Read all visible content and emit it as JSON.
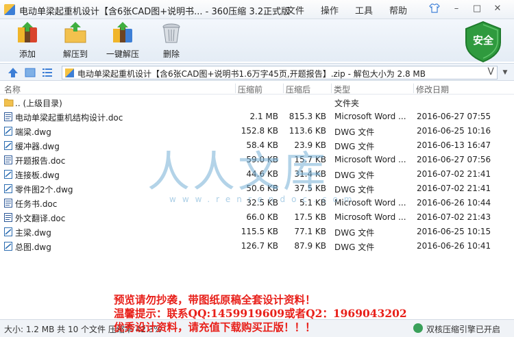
{
  "window": {
    "title": "电动单梁起重机设计【含6张CAD图+说明书... - 360压缩 3.2正式版",
    "menu": [
      "文件",
      "操作",
      "工具",
      "帮助"
    ],
    "controls": [
      "shirt-icon",
      "minimize-icon",
      "maximize-icon",
      "close-icon"
    ]
  },
  "toolbar": {
    "add_label": "添加",
    "extract_to_label": "解压到",
    "one_click_extract_label": "一键解压",
    "delete_label": "删除",
    "security_badge": "安全"
  },
  "address": {
    "path": "电动单梁起重机设计【含6张CAD图+说明书1.6万字45页,开题报告】.zip - 解包大小为 2.8 MB",
    "shortcut": "V"
  },
  "columns": [
    "名称",
    "压缩前",
    "压缩后",
    "类型",
    "修改日期"
  ],
  "files": [
    {
      "name": ".. (上级目录)",
      "size": "",
      "csize": "",
      "type": "文件夹",
      "date": "",
      "icon": "folder-icon"
    },
    {
      "name": "电动单梁起重机结构设计.doc",
      "size": "2.1 MB",
      "csize": "815.3 KB",
      "type": "Microsoft Word ...",
      "date": "2016-06-27 07:55",
      "icon": "doc-icon"
    },
    {
      "name": "端梁.dwg",
      "size": "152.8 KB",
      "csize": "113.6 KB",
      "type": "DWG 文件",
      "date": "2016-06-25 10:16",
      "icon": "dwg-icon"
    },
    {
      "name": "缓冲器.dwg",
      "size": "58.4 KB",
      "csize": "23.9 KB",
      "type": "DWG 文件",
      "date": "2016-06-13 16:47",
      "icon": "dwg-icon"
    },
    {
      "name": "开题报告.doc",
      "size": "59.0 KB",
      "csize": "15.7 KB",
      "type": "Microsoft Word ...",
      "date": "2016-06-27 07:56",
      "icon": "doc-icon"
    },
    {
      "name": "连接板.dwg",
      "size": "44.6 KB",
      "csize": "31.4 KB",
      "type": "DWG 文件",
      "date": "2016-07-02 21:41",
      "icon": "dwg-icon"
    },
    {
      "name": "零件图2个.dwg",
      "size": "50.6 KB",
      "csize": "37.5 KB",
      "type": "DWG 文件",
      "date": "2016-07-02 21:41",
      "icon": "dwg-icon"
    },
    {
      "name": "任务书.doc",
      "size": "32.5 KB",
      "csize": "5.1 KB",
      "type": "Microsoft Word ...",
      "date": "2016-06-26 10:44",
      "icon": "doc-icon"
    },
    {
      "name": "外文翻译.doc",
      "size": "66.0 KB",
      "csize": "17.5 KB",
      "type": "Microsoft Word ...",
      "date": "2016-07-02 21:43",
      "icon": "doc-icon"
    },
    {
      "name": "主梁.dwg",
      "size": "115.5 KB",
      "csize": "77.1 KB",
      "type": "DWG 文件",
      "date": "2016-06-25 10:15",
      "icon": "dwg-icon"
    },
    {
      "name": "总图.dwg",
      "size": "126.7 KB",
      "csize": "87.9 KB",
      "type": "DWG 文件",
      "date": "2016-06-26 10:41",
      "icon": "dwg-icon"
    }
  ],
  "watermark": {
    "logo": "人人文库",
    "url": "www.renrendoc.com"
  },
  "promo": {
    "line1": "预览请勿抄袭，带图纸原稿全套设计资料！",
    "line2": "温馨提示：联系QQ:1459919609或者Q2：1969043202",
    "line3": "优秀设计资料，请充值下载购买正版！！！"
  },
  "status": {
    "left": "大小: 1.2 MB 共 10 个文件 压缩率 42.3%",
    "right": "双核压缩引擎已开启"
  },
  "colors": {
    "accent": "#3d7fd6",
    "promo": "#e8201a",
    "shield": "#2f9a3e"
  }
}
